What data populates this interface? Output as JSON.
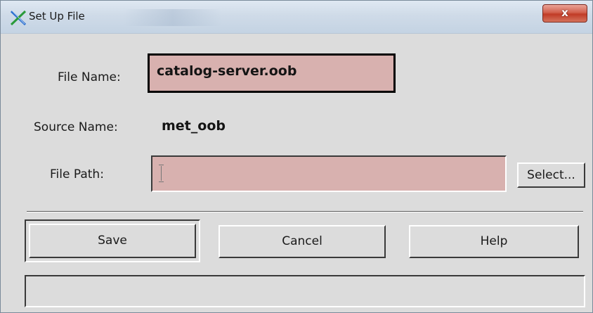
{
  "window": {
    "title": "Set Up File",
    "close_label": "x",
    "app_icon": "x-window-icon"
  },
  "form": {
    "file_name_label": "File Name:",
    "file_name_value": "catalog-server.oob",
    "source_name_label": "Source Name:",
    "source_name_value": "met_oob",
    "file_path_label": "File Path:",
    "file_path_value": "",
    "select_label": "Select..."
  },
  "actions": {
    "save_label": "Save",
    "cancel_label": "Cancel",
    "help_label": "Help"
  },
  "status": {
    "text": ""
  },
  "colors": {
    "field_bg": "#d8b1af",
    "dialog_bg": "#dcdcdc",
    "close_red": "#c13b26"
  }
}
